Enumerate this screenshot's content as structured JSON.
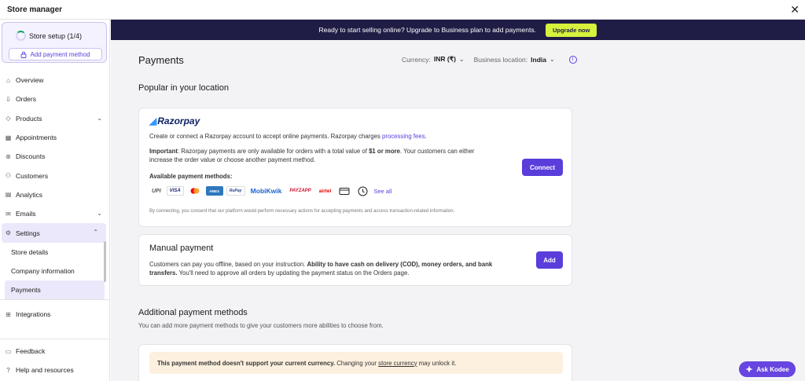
{
  "app": {
    "title": "Store manager"
  },
  "sidebar": {
    "setup_label": "Store setup (1/4)",
    "add_payment_label": "Add payment method",
    "items": [
      {
        "label": "Overview"
      },
      {
        "label": "Orders"
      },
      {
        "label": "Products"
      },
      {
        "label": "Appointments"
      },
      {
        "label": "Discounts"
      },
      {
        "label": "Customers"
      },
      {
        "label": "Analytics"
      },
      {
        "label": "Emails"
      },
      {
        "label": "Settings"
      }
    ],
    "settings_sub": [
      {
        "label": "Store details"
      },
      {
        "label": "Company information"
      },
      {
        "label": "Payments"
      }
    ],
    "integrations_label": "Integrations",
    "feedback_label": "Feedback",
    "help_label": "Help and resources"
  },
  "banner": {
    "text": "Ready to start selling online? Upgrade to Business plan to add payments.",
    "button_label": "Upgrade now"
  },
  "header": {
    "title": "Payments",
    "currency_label": "Currency:",
    "currency_value": "INR (₹)",
    "location_label": "Business location:",
    "location_value": "India"
  },
  "popular": {
    "heading": "Popular in your location",
    "razorpay": {
      "logo_text": "Razorpay",
      "description_pre": "Create or connect a Razorpay account to accept online payments. Razorpay charges ",
      "description_link": "processing fees",
      "description_post": ".",
      "important_label": "Important",
      "important_text_1": ": Razorpay payments are only available for orders with a total value of ",
      "important_bold": "$1 or more",
      "important_text_2": ". Your customers can either",
      "important_line2": "increase the order value or choose another payment method.",
      "methods_label": "Available payment methods:",
      "methods": [
        "UPI",
        "VISA",
        "Mastercard",
        "AMEX",
        "RuPay",
        "MobiKwik",
        "PAYZAPP",
        "airtel",
        "Card",
        "Clock"
      ],
      "see_all": "See all",
      "consent": "By connecting, you consent that our platform would perform necessary actions for accepting payments and access transaction-related information.",
      "connect_label": "Connect"
    },
    "manual": {
      "title": "Manual payment",
      "text_1": "Customers can pay you offline, based on your instruction. ",
      "text_bold_1": "Ability to have cash on delivery (COD), money orders, and bank",
      "text_bold_2": "transfers.",
      "text_2": " You'll need to approve all orders by updating the payment status on the Orders page.",
      "add_label": "Add"
    }
  },
  "additional": {
    "heading": "Additional payment methods",
    "subtext": "You can add more payment methods to give your customers more abilities to choose from.",
    "warning_bold": "This payment method doesn't support your current currency.",
    "warning_text": " Changing your ",
    "warning_link": "store currency",
    "warning_end": " may unlock it."
  },
  "assistant": {
    "label": "Ask Kodee"
  },
  "colors": {
    "accent": "#5a3ddb",
    "banner": "#1f1d45",
    "upgrade": "#d7f23c"
  }
}
